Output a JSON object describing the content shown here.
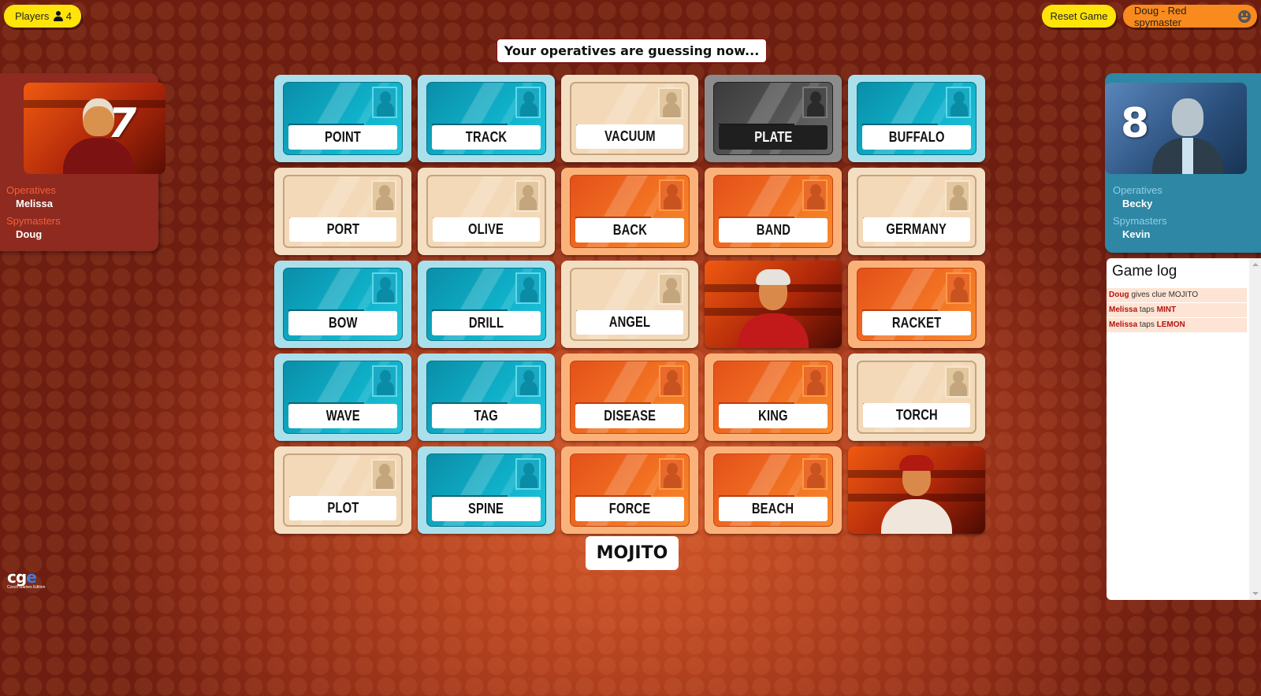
{
  "header": {
    "players_label": "Players",
    "players_count": "4",
    "reset_label": "Reset Game",
    "user_label": "Doug - Red spymaster"
  },
  "status_banner": "Your operatives are guessing now...",
  "teams": {
    "red": {
      "remaining": "7",
      "operatives_label": "Operatives",
      "operatives": [
        "Melissa"
      ],
      "spymasters_label": "Spymasters",
      "spymasters": [
        "Doug"
      ],
      "color": "#8e2a1f"
    },
    "blue": {
      "remaining": "8",
      "operatives_label": "Operatives",
      "operatives": [
        "Becky"
      ],
      "spymasters_label": "Spymasters",
      "spymasters": [
        "Kevin"
      ],
      "color": "#2e87a4"
    }
  },
  "board": {
    "cards": [
      {
        "word": "POINT",
        "type": "blue"
      },
      {
        "word": "TRACK",
        "type": "blue"
      },
      {
        "word": "VACUUM",
        "type": "neutral"
      },
      {
        "word": "PLATE",
        "type": "assassin"
      },
      {
        "word": "BUFFALO",
        "type": "blue"
      },
      {
        "word": "PORT",
        "type": "neutral"
      },
      {
        "word": "OLIVE",
        "type": "neutral"
      },
      {
        "word": "BACK",
        "type": "red"
      },
      {
        "word": "BAND",
        "type": "red"
      },
      {
        "word": "GERMANY",
        "type": "neutral"
      },
      {
        "word": "BOW",
        "type": "blue"
      },
      {
        "word": "DRILL",
        "type": "blue"
      },
      {
        "word": "ANGEL",
        "type": "neutral"
      },
      {
        "word": "",
        "type": "revealed-red",
        "agent": "female"
      },
      {
        "word": "RACKET",
        "type": "red"
      },
      {
        "word": "WAVE",
        "type": "blue"
      },
      {
        "word": "TAG",
        "type": "blue"
      },
      {
        "word": "DISEASE",
        "type": "red"
      },
      {
        "word": "KING",
        "type": "red"
      },
      {
        "word": "TORCH",
        "type": "neutral"
      },
      {
        "word": "PLOT",
        "type": "neutral"
      },
      {
        "word": "SPINE",
        "type": "blue"
      },
      {
        "word": "FORCE",
        "type": "red"
      },
      {
        "word": "BEACH",
        "type": "red"
      },
      {
        "word": "",
        "type": "revealed-red",
        "agent": "male"
      }
    ]
  },
  "clue": "MOJITO",
  "game_log": {
    "title": "Game log",
    "entries": [
      {
        "actor": "Doug",
        "action": " gives clue ",
        "target": "MOJITO",
        "target_bold": false
      },
      {
        "actor": "Melissa",
        "action": " taps ",
        "target": "MINT",
        "target_bold": true
      },
      {
        "actor": "Melissa",
        "action": " taps ",
        "target": "LEMON",
        "target_bold": true
      }
    ]
  },
  "logo": {
    "mark": [
      "c",
      "g",
      "e"
    ],
    "subtitle": "Czech Games Edition"
  }
}
